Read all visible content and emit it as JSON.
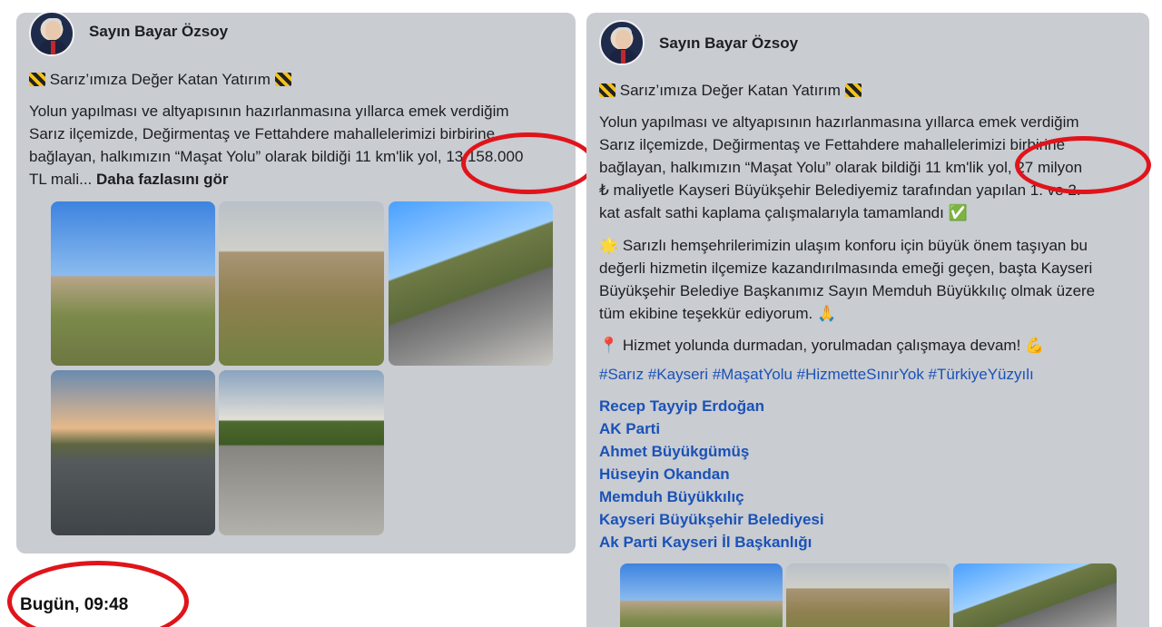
{
  "left_post": {
    "author": "Sayın Bayar Özsoy",
    "headline": "Sarız’ımıza Değer Katan Yatırım",
    "body_lines": [
      "Yolun yapılması ve altyapısının hazırlanmasına yıllarca emek verdiğim",
      "Sarız ilçemizde, Değirmentaş ve Fettahdere mahallelerimizi birbirine",
      "bağlayan, halkımızın “Maşat Yolu” olarak bildiği 11 km'lik yol, 13.158.000",
      "TL mali..."
    ],
    "see_more": "Daha fazlasını gör",
    "timestamp": "Bugün, 09:48"
  },
  "right_post": {
    "author": "Sayın Bayar Özsoy",
    "headline": "Sarız’ımıza Değer Katan Yatırım",
    "paragraph1": [
      "Yolun yapılması ve altyapısının hazırlanmasına yıllarca emek verdiğim",
      "Sarız ilçemizde, Değirmentaş ve Fettahdere mahallelerimizi birbirine",
      "bağlayan, halkımızın “Maşat Yolu” olarak bildiği 11 km'lik yol, 27 milyon",
      "₺ maliyetle Kayseri Büyükşehir Belediyemiz tarafından yapılan 1. ve 2.",
      "kat asfalt sathi kaplama çalışmalarıyla tamamlandı ✅"
    ],
    "paragraph2": [
      "🌟 Sarızlı hemşehrilerimizin ulaşım konforu için büyük önem taşıyan bu",
      "değerli hizmetin ilçemize kazandırılmasında emeği geçen, başta Kayseri",
      "Büyükşehir Belediye Başkanımız Sayın Memduh Büyükkılıç olmak üzere",
      "tüm ekibine teşekkür ediyorum. 🙏"
    ],
    "paragraph3": "📍 Hizmet yolunda durmadan, yorulmadan çalışmaya devam! 💪",
    "hashtags": "#Sarız #Kayseri #MaşatYolu #HizmetteSınırYok #TürkiyeYüzyılı",
    "mentions": [
      "Recep Tayyip Erdoğan",
      "AK Parti",
      "Ahmet Büyükgümüş",
      "Hüseyin Okandan",
      "Memduh Büyükkılıç",
      "Kayseri Büyükşehir Belediyesi",
      "Ak Parti Kayseri İl Başkanlığı"
    ]
  },
  "colors": {
    "panel_bg": "#c9ccd1",
    "link": "#1a52b8",
    "annotation_red": "#e0141b"
  }
}
